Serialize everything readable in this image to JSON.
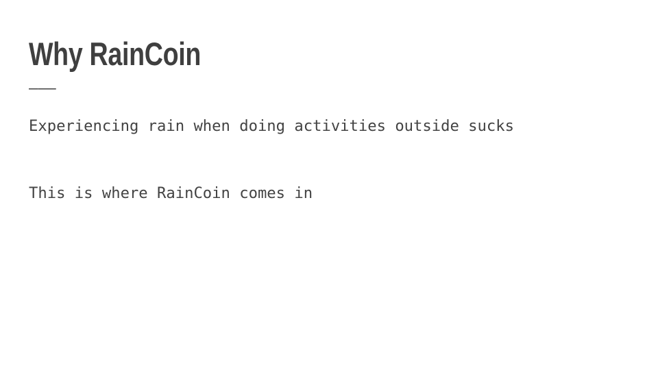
{
  "slide": {
    "title": "Why RainCoin",
    "divider": "———",
    "body": {
      "line_1": "Experiencing rain when doing activities outside sucks",
      "line_2": "This is where RainCoin comes in"
    }
  },
  "colors": {
    "background": "#ffffff",
    "title_text": "#3f3f3f",
    "body_text": "#434343",
    "divider": "#434343"
  }
}
